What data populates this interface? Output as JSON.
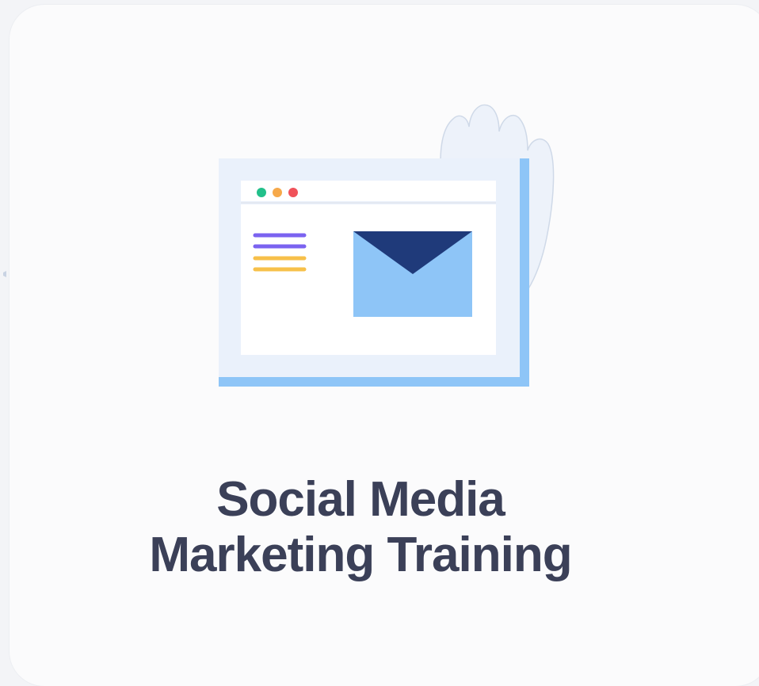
{
  "card": {
    "title_line1": "Social Media",
    "title_line2": "Marketing Training"
  },
  "illustration": {
    "icon": "email-marketing-browser-icon",
    "window_dots": [
      "#22c08a",
      "#f6a94a",
      "#f0525a"
    ],
    "menu_lines_colors": [
      "#7b63f0",
      "#7b63f0",
      "#f7c04a",
      "#f7c04a"
    ],
    "envelope_color": "#8ec5f7",
    "envelope_flap_color": "#1f3a7a",
    "window_frame_color": "#8ec5f7",
    "hand_color": "#e8eef8"
  }
}
